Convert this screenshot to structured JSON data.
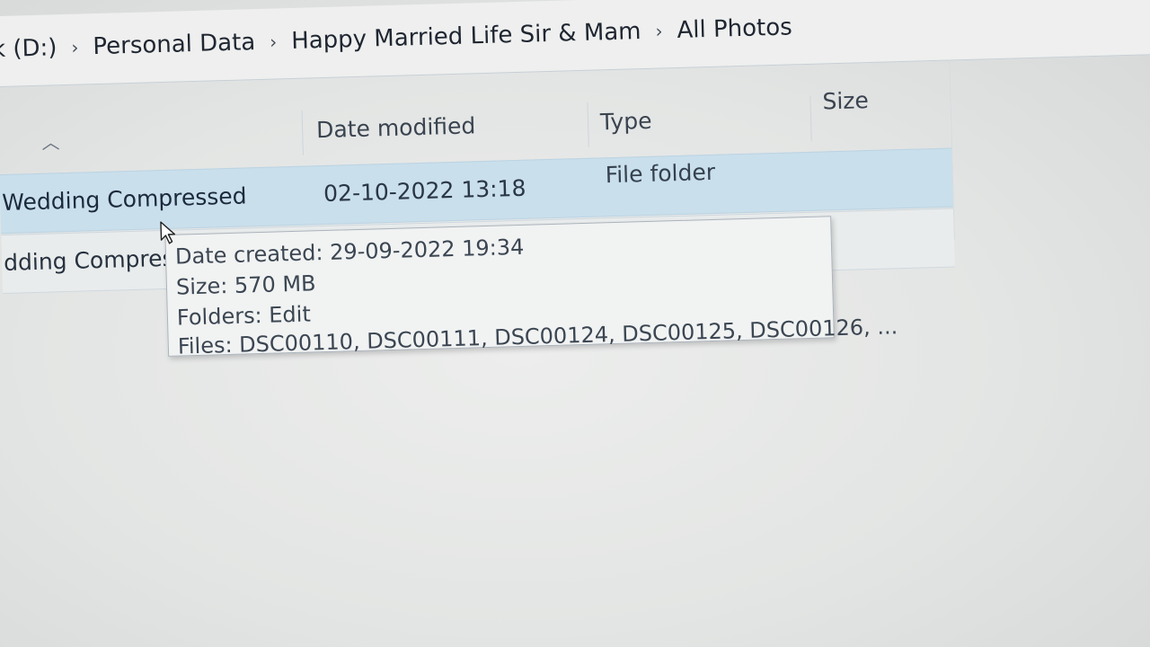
{
  "breadcrumb": {
    "items": [
      "sk (D:)",
      "Personal Data",
      "Happy Married Life Sir & Mam",
      "All Photos"
    ],
    "separator": "›"
  },
  "columns": {
    "date_modified": "Date modified",
    "type": "Type",
    "size": "Size",
    "sort_icon": "chevron-up-icon"
  },
  "rows": [
    {
      "name": "Wedding Compressed",
      "date_modified": "02-10-2022 13:18",
      "type": "File folder",
      "selected": true
    },
    {
      "name": "dding Compres"
    }
  ],
  "tooltip": {
    "date_created": "Date created: 29-09-2022 19:34",
    "size": "Size: 570 MB",
    "folders": "Folders: Edit",
    "files": "Files: DSC00110, DSC00111, DSC00124, DSC00125, DSC00126, ..."
  },
  "colors": {
    "selection": "#c9dfec",
    "background": "#e8eaea",
    "text": "#1f2631"
  }
}
